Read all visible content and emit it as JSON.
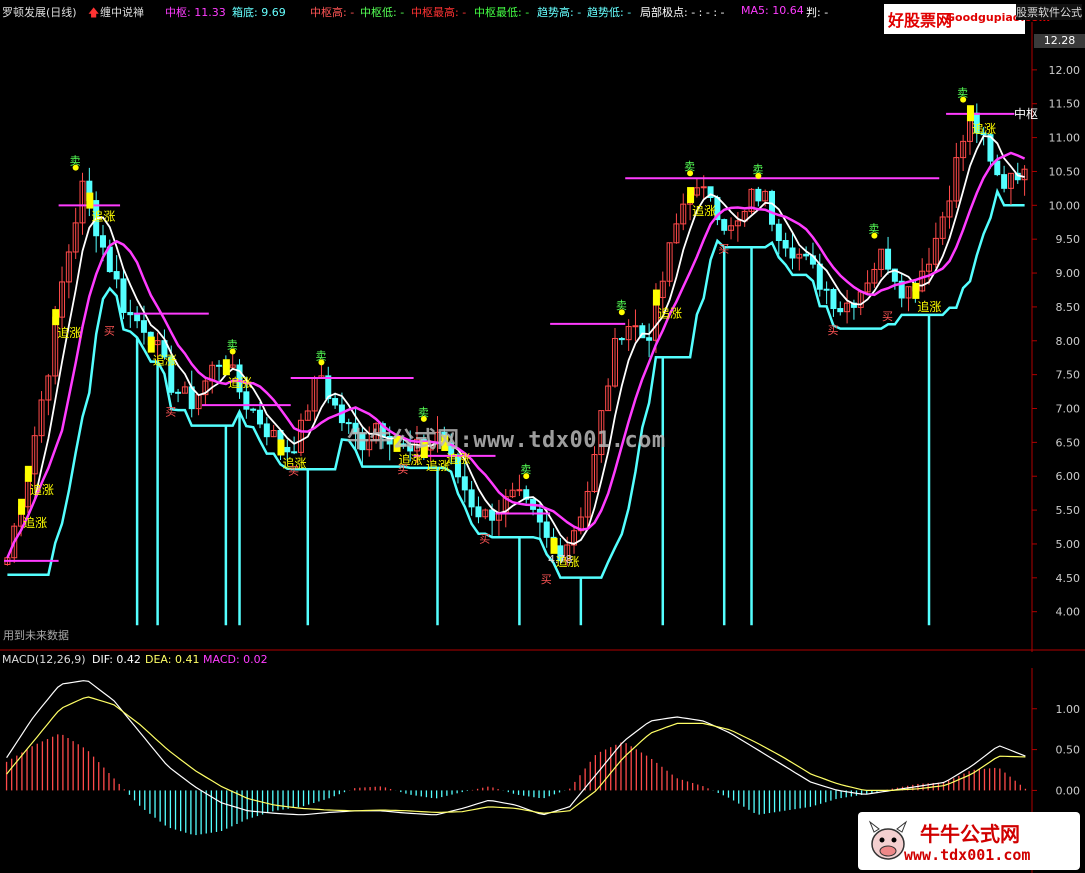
{
  "header": {
    "stock_name": "罗顿发展(日线)",
    "indicator_name": "缠中说禅",
    "items": [
      {
        "label": "中枢: 11.33",
        "color": "#ff3cff"
      },
      {
        "label": "箱底: 9.69",
        "color": "#66ffff"
      },
      {
        "label": "中枢高: -",
        "color": "#ff5555"
      },
      {
        "label": "中枢低: -",
        "color": "#55ff55"
      },
      {
        "label": "中枢最高: -",
        "color": "#ff3333"
      },
      {
        "label": "中枢最低: -",
        "color": "#44ff44"
      },
      {
        "label": "趋势高: -",
        "color": "#66ffff"
      },
      {
        "label": "趋势低: -",
        "color": "#66ffff"
      },
      {
        "label": "局部极点: - : - : -",
        "color": "#ffffff"
      },
      {
        "label": "MA5: 10.64",
        "color": "#ff3cff"
      },
      {
        "label": "判: -",
        "color": "#ffffff"
      }
    ]
  },
  "colors": {
    "up": "#ff4a4a",
    "down": "#54ffff",
    "zhongshu": "#ff3cff",
    "ma": "#ffffff",
    "signal": "#ffff00",
    "axis": "#b00000",
    "macd_pos": "#ff4a4a",
    "macd_neg": "#54ffff",
    "dif": "#ffffff",
    "dea": "#ffff66"
  },
  "labels": {
    "future_note": "用到未来数据",
    "price_tag": "12.28",
    "zhongshu_right": "中枢",
    "signal_word": "追涨",
    "sell_word": "卖",
    "buy_word": "买"
  },
  "watermark": "牛牛公式网:www.tdx001.com",
  "logo_top": {
    "title": "好股票网",
    "url": "Goodgupiao.com",
    "software": "股票软件公式"
  },
  "logo_bottom": {
    "title": "牛牛公式网",
    "url": "www.tdx001.com"
  },
  "macd_header": {
    "name": "MACD(12,26,9)",
    "dif": "DIF: 0.42",
    "dea": "DEA: 0.41",
    "macd": "MACD: 0.02"
  },
  "chart_data": [
    {
      "type": "candlestick",
      "ylim": [
        3.7,
        12.5
      ],
      "yticks": [
        "4.00",
        "4.50",
        "5.00",
        "5.50",
        "6.00",
        "6.50",
        "7.00",
        "7.50",
        "8.00",
        "8.50",
        "9.00",
        "9.50",
        "10.00",
        "10.50",
        "11.00",
        "11.50",
        "12.00"
      ],
      "close_path": [
        4.8,
        5.5,
        6.2,
        7.0,
        7.8,
        8.8,
        9.6,
        10.3,
        9.8,
        9.3,
        8.9,
        8.4,
        8.3,
        8.2,
        7.8,
        7.4,
        7.2,
        7.1,
        7.3,
        7.6,
        7.8,
        7.4,
        7.1,
        6.9,
        6.7,
        6.5,
        6.4,
        6.6,
        7.2,
        7.5,
        7.1,
        6.8,
        6.6,
        6.5,
        6.8,
        6.7,
        6.5,
        6.3,
        6.4,
        6.5,
        6.7,
        6.2,
        5.9,
        5.6,
        5.4,
        5.5,
        5.6,
        5.7,
        5.5,
        5.3,
        5.0,
        4.9,
        5.1,
        5.5,
        6.0,
        7.0,
        7.8,
        8.3,
        8.2,
        8.0,
        8.5,
        9.2,
        9.8,
        10.3,
        10.1,
        10.2,
        9.8,
        9.6,
        9.8,
        10.2,
        10.1,
        9.7,
        9.5,
        9.3,
        9.1,
        8.9,
        8.7,
        8.5,
        8.6,
        8.8,
        9.1,
        9.3,
        9.0,
        8.7,
        8.9,
        9.2,
        9.6,
        10.2,
        10.8,
        11.3,
        11.0,
        10.5,
        10.3,
        10.6,
        10.4
      ],
      "zhongshu_segments": [
        {
          "start": 0,
          "end": 8,
          "price": 4.75
        },
        {
          "start": 8,
          "end": 17,
          "price": 10.0
        },
        {
          "start": 19,
          "end": 30,
          "price": 8.4
        },
        {
          "start": 29,
          "end": 42,
          "price": 7.05
        },
        {
          "start": 42,
          "end": 60,
          "price": 7.45
        },
        {
          "start": 60,
          "end": 72,
          "price": 6.3
        },
        {
          "start": 72,
          "end": 80,
          "price": 5.45
        },
        {
          "start": 80,
          "end": 91,
          "price": 8.25
        },
        {
          "start": 91,
          "end": 137,
          "price": 10.4
        },
        {
          "start": 138,
          "end": 148,
          "price": 11.35
        }
      ],
      "annotation": "4.78"
    },
    {
      "type": "bar",
      "title": "MACD(12,26,9)",
      "ylim": [
        -0.95,
        1.45
      ],
      "yticks": [
        "0.00",
        "0.50",
        "1.00"
      ],
      "dif_path": [
        0.4,
        0.9,
        1.3,
        1.35,
        1.1,
        0.7,
        0.3,
        0.05,
        -0.15,
        -0.25,
        -0.28,
        -0.3,
        -0.27,
        -0.25,
        -0.25,
        -0.28,
        -0.3,
        -0.22,
        -0.12,
        -0.18,
        -0.3,
        -0.2,
        0.2,
        0.6,
        0.85,
        0.9,
        0.85,
        0.7,
        0.5,
        0.3,
        0.1,
        0.0,
        -0.05,
        0.0,
        0.05,
        0.1,
        0.3,
        0.55,
        0.42
      ],
      "dea_path": [
        0.2,
        0.6,
        1.0,
        1.15,
        1.05,
        0.8,
        0.5,
        0.25,
        0.05,
        -0.1,
        -0.18,
        -0.22,
        -0.24,
        -0.25,
        -0.24,
        -0.25,
        -0.27,
        -0.26,
        -0.2,
        -0.22,
        -0.28,
        -0.25,
        0.0,
        0.4,
        0.7,
        0.82,
        0.82,
        0.74,
        0.58,
        0.4,
        0.2,
        0.08,
        0.0,
        0.0,
        0.02,
        0.06,
        0.2,
        0.42,
        0.41
      ],
      "hist_path": [
        0.35,
        0.55,
        0.7,
        0.5,
        0.15,
        -0.2,
        -0.45,
        -0.55,
        -0.5,
        -0.35,
        -0.25,
        -0.2,
        -0.1,
        0.03,
        0.05,
        -0.05,
        -0.1,
        -0.02,
        0.05,
        -0.05,
        -0.1,
        0.02,
        0.45,
        0.6,
        0.4,
        0.15,
        0.05,
        -0.1,
        -0.3,
        -0.25,
        -0.2,
        -0.1,
        -0.05,
        0.02,
        0.08,
        0.1,
        0.25,
        0.28,
        0.02
      ]
    }
  ]
}
